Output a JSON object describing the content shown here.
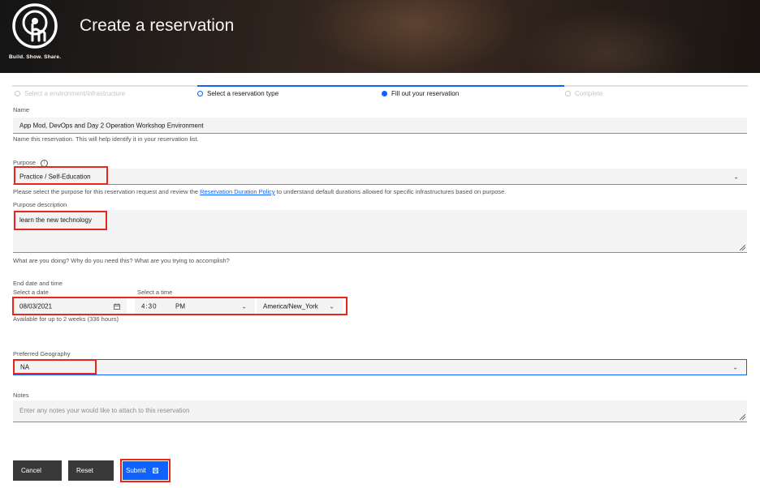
{
  "header": {
    "title": "Create a reservation",
    "logo_text": "Build. Show. Share."
  },
  "steps": [
    {
      "label": "Select a environment/infrastructure",
      "state": "disabled"
    },
    {
      "label": "Select a reservation type",
      "state": "done"
    },
    {
      "label": "Fill out your reservation",
      "state": "current"
    },
    {
      "label": "Complete",
      "state": "disabled"
    }
  ],
  "name": {
    "label": "Name",
    "value": "App Mod, DevOps and Day 2 Operation Workshop Environment",
    "helper": "Name this reservation. This will help identify it in your reservation list."
  },
  "purpose": {
    "label": "Purpose",
    "value": "Practice / Self-Education",
    "helper_before": "Please select the purpose for this reservation request and review the ",
    "helper_link": "Reservation Duration Policy",
    "helper_after": " to understand default durations allowed for specific infrastructures based on purpose."
  },
  "purpose_description": {
    "label": "Purpose description",
    "value": "learn the new technology",
    "helper": "What are you doing? Why do you need this? What are you trying to accomplish?"
  },
  "end_date": {
    "label": "End date and time",
    "date_label": "Select a date",
    "time_label": "Select a time",
    "date_value": "08/03/2021",
    "time_value": "4:30",
    "ampm_value": "PM",
    "timezone_value": "America/New_York",
    "helper": "Available for up to 2 weeks (336 hours)"
  },
  "geography": {
    "label": "Preferred Geography",
    "value": "NA"
  },
  "notes": {
    "label": "Notes",
    "placeholder": "Enter any notes your would like to attach to this reservation"
  },
  "buttons": {
    "cancel": "Cancel",
    "reset": "Reset",
    "submit": "Submit"
  },
  "colors": {
    "accent": "#0f62fe",
    "highlight": "#e8261b",
    "field_bg": "#f4f4f4",
    "dark_button": "#393939"
  }
}
